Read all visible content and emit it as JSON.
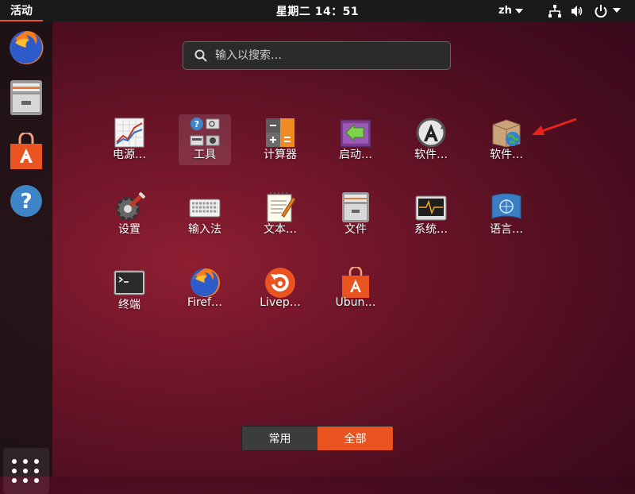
{
  "topbar": {
    "activities": "活动",
    "clock": "星期二 14：51",
    "language": "zh"
  },
  "search": {
    "placeholder": "输入以搜索…"
  },
  "apps": [
    {
      "label": "电源…",
      "icon": "power-statistics-icon"
    },
    {
      "label": "工具",
      "icon": "utilities-folder-icon"
    },
    {
      "label": "计算器",
      "icon": "calculator-icon"
    },
    {
      "label": "启动…",
      "icon": "startup-disk-icon"
    },
    {
      "label": "软件…",
      "icon": "software-updater-icon"
    },
    {
      "label": "软件…",
      "icon": "software-sources-icon"
    },
    {
      "label": "设置",
      "icon": "settings-gear-icon"
    },
    {
      "label": "输入法",
      "icon": "keyboard-icon"
    },
    {
      "label": "文本…",
      "icon": "text-editor-icon"
    },
    {
      "label": "文件",
      "icon": "file-cabinet-icon"
    },
    {
      "label": "系统…",
      "icon": "system-monitor-icon"
    },
    {
      "label": "语言…",
      "icon": "language-flag-icon"
    },
    {
      "label": "终端",
      "icon": "terminal-icon"
    },
    {
      "label": "Firef…",
      "icon": "firefox-icon"
    },
    {
      "label": "Livep…",
      "icon": "livepatch-icon"
    },
    {
      "label": "Ubun…",
      "icon": "ubuntu-software-icon"
    }
  ],
  "switch": {
    "frequent": "常用",
    "all": "全部"
  },
  "colors": {
    "accent": "#e95420",
    "topbar": "#1a1a1a"
  }
}
